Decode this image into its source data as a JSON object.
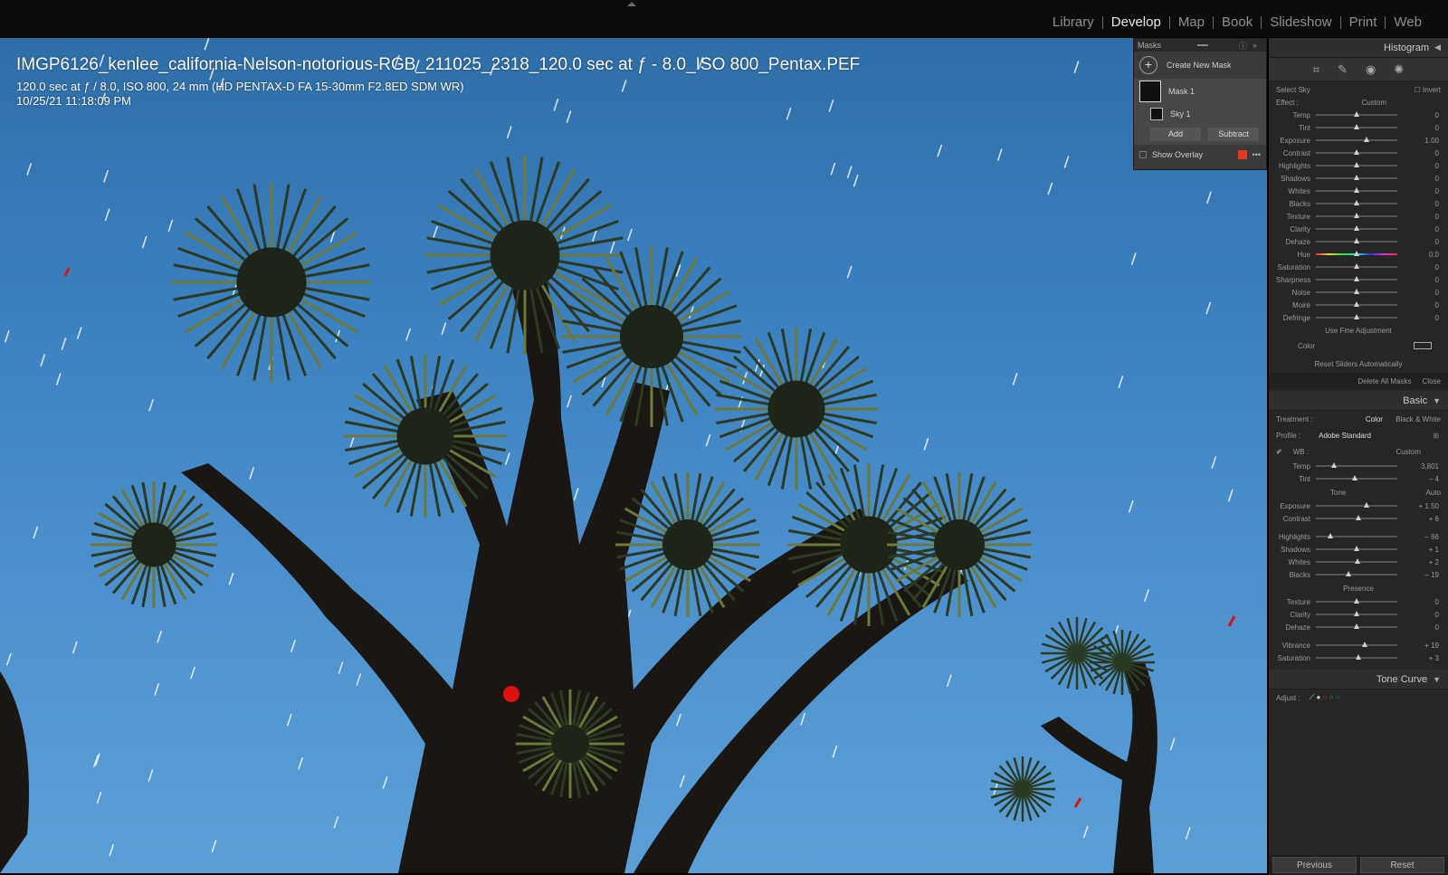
{
  "modules": {
    "items": [
      "Library",
      "Develop",
      "Map",
      "Book",
      "Slideshow",
      "Print",
      "Web"
    ],
    "active": "Develop"
  },
  "overlay": {
    "title": "IMGP6126_kenlee_california-Nelson-notorious-RGB_211025_2318_120.0 sec at ƒ - 8.0_ISO 800_Pentax.PEF",
    "exif": "120.0 sec at ƒ / 8.0, ISO 800, 24 mm (HD PENTAX-D FA 15-30mm F2.8ED SDM WR)",
    "date": "10/25/21 11:18:09 PM"
  },
  "masks": {
    "title": "Masks",
    "create": "Create New Mask",
    "mask1": "Mask 1",
    "sky1": "Sky 1",
    "add": "Add",
    "subtract": "Subtract",
    "show_overlay": "Show Overlay",
    "overlay_color": "#e03a1f"
  },
  "histogram": {
    "title": "Histogram"
  },
  "mask_panel": {
    "select_sky": "Select Sky",
    "invert": "Invert",
    "effect_label": "Effect :",
    "effect_value": "Custom",
    "use_fine": "Use Fine Adjustment",
    "color_label": "Color",
    "reset_sliders": "Reset Sliders Automatically",
    "delete_all": "Delete All Masks",
    "close": "Close",
    "sliders": [
      {
        "label": "Temp",
        "value": "0",
        "pos": 0.5
      },
      {
        "label": "Tint",
        "value": "0",
        "pos": 0.5
      },
      {
        "label": "Exposure",
        "value": "1.00",
        "pos": 0.62
      },
      {
        "label": "Contrast",
        "value": "0",
        "pos": 0.5
      },
      {
        "label": "Highlights",
        "value": "0",
        "pos": 0.5
      },
      {
        "label": "Shadows",
        "value": "0",
        "pos": 0.5
      },
      {
        "label": "Whites",
        "value": "0",
        "pos": 0.5
      },
      {
        "label": "Blacks",
        "value": "0",
        "pos": 0.5
      },
      {
        "label": "Texture",
        "value": "0",
        "pos": 0.5
      },
      {
        "label": "Clarity",
        "value": "0",
        "pos": 0.5
      },
      {
        "label": "Dehaze",
        "value": "0",
        "pos": 0.5
      },
      {
        "label": "Hue",
        "value": "0.0",
        "pos": 0.5
      },
      {
        "label": "Saturation",
        "value": "0",
        "pos": 0.5
      },
      {
        "label": "Sharpness",
        "value": "0",
        "pos": 0.5
      },
      {
        "label": "Noise",
        "value": "0",
        "pos": 0.5
      },
      {
        "label": "Moiré",
        "value": "0",
        "pos": 0.5
      },
      {
        "label": "Defringe",
        "value": "0",
        "pos": 0.5
      }
    ]
  },
  "basic": {
    "title": "Basic",
    "treatment_label": "Treatment :",
    "treatment_color": "Color",
    "treatment_bw": "Black & White",
    "profile_label": "Profile :",
    "profile_value": "Adobe Standard",
    "wb_label": "WB :",
    "wb_value": "Custom",
    "temp": {
      "label": "Temp",
      "value": "3,801",
      "pos": 0.22
    },
    "tint": {
      "label": "Tint",
      "value": "– 4",
      "pos": 0.48
    },
    "tone_label": "Tone",
    "auto": "Auto",
    "presence_label": "Presence",
    "tone_sliders": [
      {
        "label": "Exposure",
        "value": "+ 1.50",
        "pos": 0.62
      },
      {
        "label": "Contrast",
        "value": "+ 6",
        "pos": 0.52
      }
    ],
    "hl_sliders": [
      {
        "label": "Highlights",
        "value": "– 66",
        "pos": 0.18
      },
      {
        "label": "Shadows",
        "value": "+ 1",
        "pos": 0.5
      },
      {
        "label": "Whites",
        "value": "+ 2",
        "pos": 0.51
      },
      {
        "label": "Blacks",
        "value": "– 19",
        "pos": 0.4
      }
    ],
    "presence_sliders": [
      {
        "label": "Texture",
        "value": "0",
        "pos": 0.5
      },
      {
        "label": "Clarity",
        "value": "0",
        "pos": 0.5
      },
      {
        "label": "Dehaze",
        "value": "0",
        "pos": 0.5
      }
    ],
    "vib_sliders": [
      {
        "label": "Vibrance",
        "value": "+ 19",
        "pos": 0.6
      },
      {
        "label": "Saturation",
        "value": "+ 3",
        "pos": 0.52
      }
    ]
  },
  "tone_curve": {
    "title": "Tone Curve",
    "adjust_label": "Adjust :"
  },
  "buttons": {
    "previous": "Previous",
    "reset": "Reset"
  }
}
